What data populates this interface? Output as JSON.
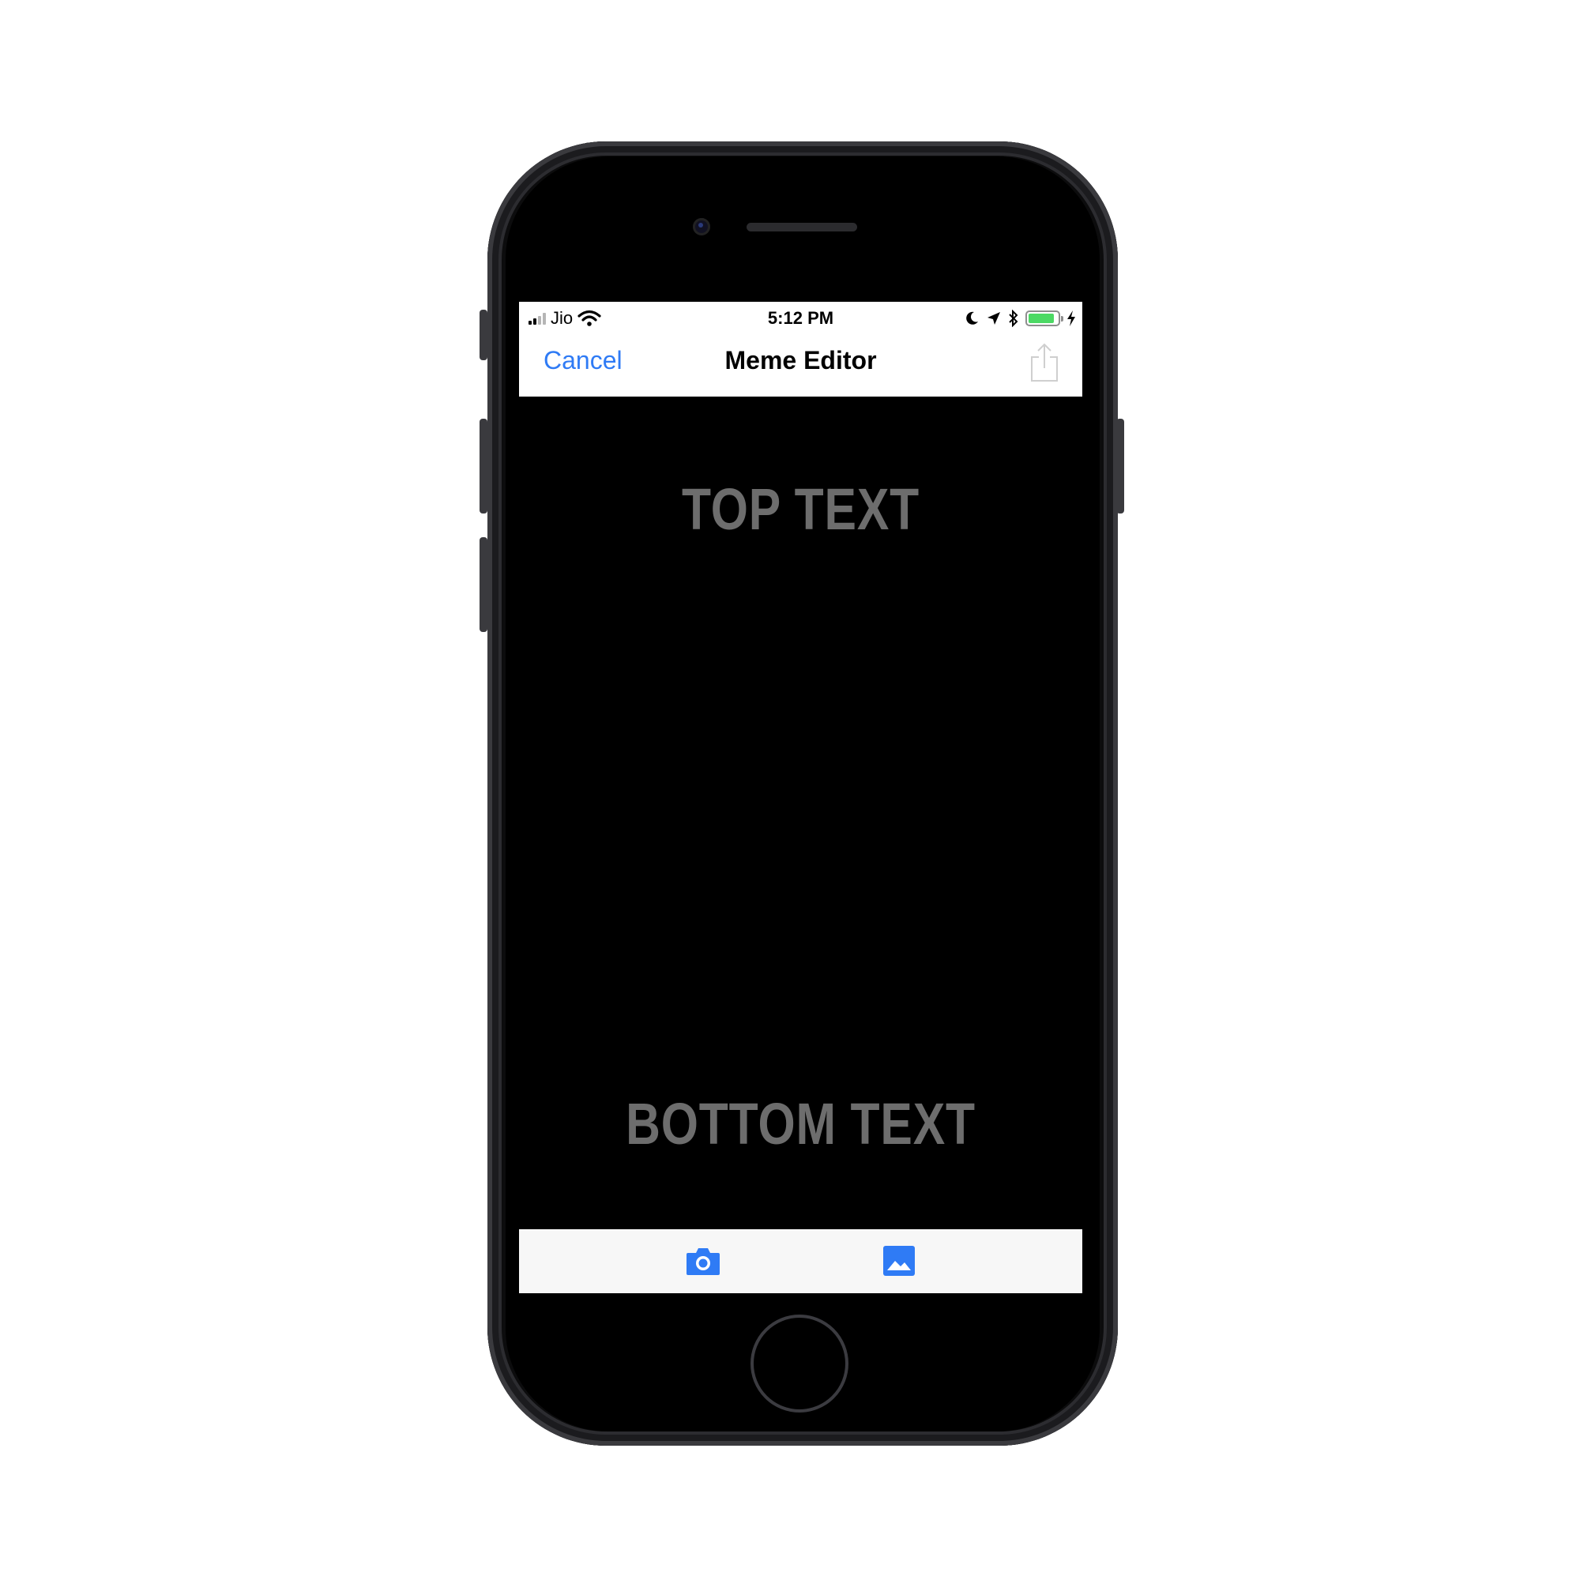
{
  "status_bar": {
    "carrier": "Jio",
    "time": "5:12 PM",
    "icons": [
      "signal-icon",
      "wifi-icon",
      "moon-icon",
      "location-arrow-icon",
      "bluetooth-icon",
      "battery-icon",
      "charging-bolt-icon"
    ],
    "battery_level": 0.9
  },
  "nav_bar": {
    "cancel_label": "Cancel",
    "title": "Meme Editor",
    "share_icon": "share-icon"
  },
  "meme": {
    "top_text": "TOP TEXT",
    "bottom_text": "BOTTOM TEXT"
  },
  "toolbar": {
    "items": [
      "camera-icon",
      "photo-library-icon"
    ]
  },
  "colors": {
    "accent": "#2f7bf5",
    "meme_text": "#6d6d6d",
    "battery": "#4cd964"
  }
}
